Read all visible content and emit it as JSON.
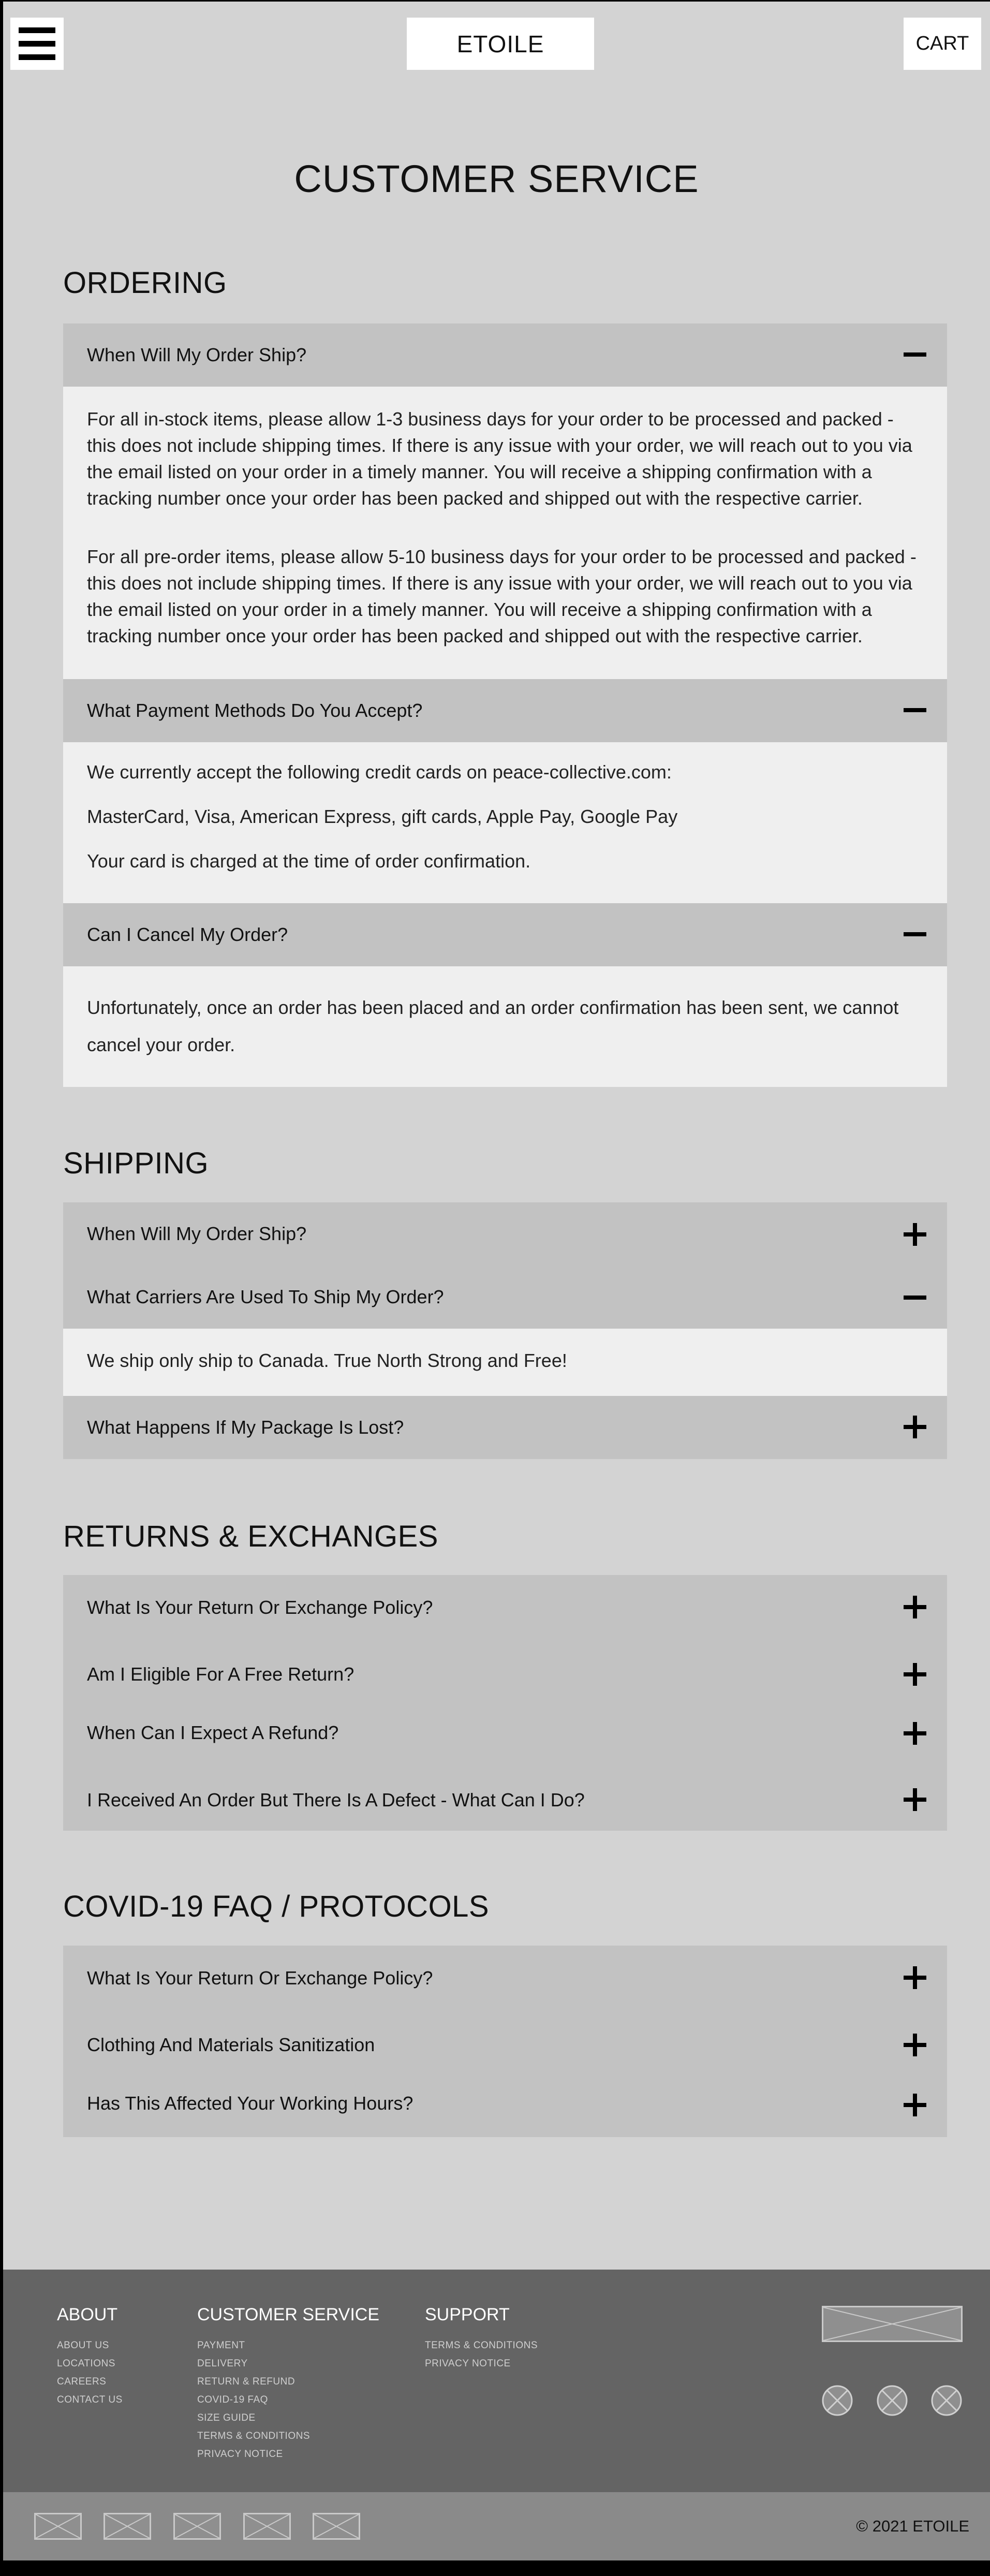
{
  "header": {
    "menu_icon": "hamburger-menu-icon",
    "logo": "ETOILE",
    "cart": "CART"
  },
  "page_title": "CUSTOMER SERVICE",
  "sections": {
    "ordering": {
      "title": "ORDERING",
      "q1": "When Will My Order Ship?",
      "q1_a1": "For all in-stock items, please allow 1-3 business days for your order to be processed and packed - this does not include shipping times. If there is any issue with your order, we will reach out to you via the email listed on your order in a timely manner. You will receive a shipping confirmation with a tracking number once your order has been packed and shipped out with the respective carrier.",
      "q1_a2": "For all pre-order items, please allow 5-10 business days for your order to be processed and packed - this does not include shipping times. If there is any issue with your order, we will reach out to you via the email listed on your order in a timely manner. You will receive a shipping confirmation with a tracking number once your order has been packed and shipped out with the respective carrier.",
      "q2": "What Payment Methods Do You Accept?",
      "q2_a1": "We currently accept the following credit cards on peace-collective.com:",
      "q2_a2": "MasterCard, Visa, American Express, gift cards, Apple Pay, Google Pay",
      "q2_a3": "Your card is charged at the time of order confirmation.",
      "q3": "Can I Cancel My Order?",
      "q3_a1": "Unfortunately, once an order has been placed and an order confirmation has been sent, we cannot cancel your order."
    },
    "shipping": {
      "title": "SHIPPING",
      "q1": "When Will My Order Ship?",
      "q2": "What Carriers Are Used To Ship My Order?",
      "q2_a1": "We ship only ship to Canada. True North Strong and Free!",
      "q3": "What Happens If My Package Is Lost?"
    },
    "returns": {
      "title": "RETURNS & EXCHANGES",
      "q1": "What Is Your Return Or Exchange Policy?",
      "q2": "Am I Eligible For A Free Return?",
      "q3": "When Can I Expect A Refund?",
      "q4": "I Received An Order But There Is A Defect - What Can I Do?"
    },
    "covid": {
      "title": "COVID-19 FAQ / PROTOCOLS",
      "q1": "What Is Your Return Or Exchange Policy?",
      "q2": "Clothing And Materials Sanitization",
      "q3": "Has This Affected Your Working Hours?"
    }
  },
  "footer": {
    "about": {
      "title": "ABOUT",
      "links": [
        "ABOUT US",
        "LOCATIONS",
        "CAREERS",
        "CONTACT US"
      ]
    },
    "customer_service": {
      "title": "CUSTOMER SERVICE",
      "links": [
        "PAYMENT",
        "DELIVERY",
        "RETURN & REFUND",
        "COVID-19 FAQ",
        "SIZE GUIDE",
        "TERMS & CONDITIONS",
        "PRIVACY NOTICE"
      ]
    },
    "support": {
      "title": "SUPPORT",
      "links": [
        "TERMS & CONDITIONS",
        "PRIVACY NOTICE"
      ]
    },
    "copyright": "© 2021 ETOILE"
  },
  "colors": {
    "page_bg": "#d3d3d3",
    "question_bg": "#c2c2c2",
    "answer_bg": "#efefef",
    "footer_bg": "#646464",
    "bottom_bar_bg": "#8a8a8a"
  }
}
